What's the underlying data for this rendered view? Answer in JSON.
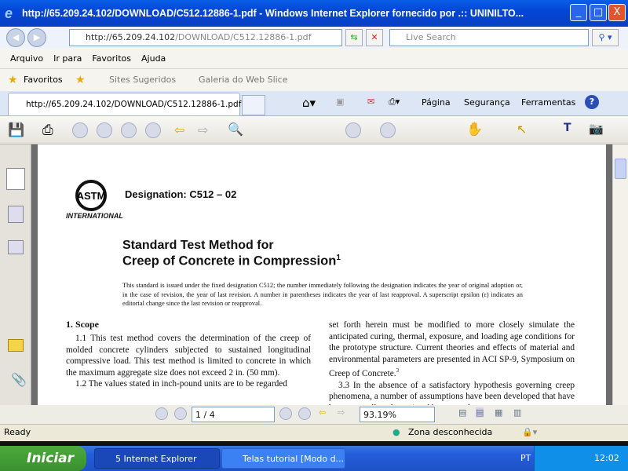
{
  "window": {
    "title": "http://65.209.24.102/DOWNLOAD/C512.12886-1.pdf - Windows Internet Explorer fornecido por .:: UNINILTO...",
    "minimize": "_",
    "maximize": "□",
    "close": "X"
  },
  "address": {
    "host": "http://65.209.24.102",
    "path": "/DOWNLOAD/C512.12886-1.pdf",
    "search_placeholder": "Live Search"
  },
  "menu": [
    "Arquivo",
    "Ir para",
    "Favoritos",
    "Ajuda"
  ],
  "favorites": {
    "label": "Favoritos",
    "items": [
      "Sites Sugeridos",
      "Galeria do Web Slice"
    ]
  },
  "tab": {
    "label": "http://65.209.24.102/DOWNLOAD/C512.12886-1.pdf"
  },
  "command_bar": [
    "Página",
    "Segurança",
    "Ferramentas"
  ],
  "document": {
    "designation": "Designation: C512 – 02",
    "logo_text": "INTERNATIONAL",
    "title_line1": "Standard Test Method for",
    "title_line2": "Creep of Concrete in Compression",
    "title_sup": "1",
    "notice": "This standard is issued under the fixed designation C512; the number immediately following the designation indicates the year of original adoption or, in the case of revision, the year of last revision. A number in parentheses indicates the year of last reapproval. A superscript epsilon (ε) indicates an editorial change since the last revision or reapproval.",
    "section_heading": "1. Scope",
    "left_p1": "1.1 This test method covers the determination of the creep of molded concrete cylinders subjected to sustained longitudinal compressive load. This test method is limited to concrete in which the maximum aggregate size does not exceed 2 in. (50 mm).",
    "left_p2": "1.2 The values stated in inch-pound units are to be regarded",
    "right_p1": "set forth herein must be modified to more closely simulate the anticipated curing, thermal, exposure, and loading age conditions for the prototype structure. Current theories and effects of material and environmental parameters are presented in ACI SP-9, Symposium on Creep of Concrete.",
    "right_p1_sup": "3",
    "right_p2": "3.3 In the absence of a satisfactory hypothesis governing creep phenomena, a number of assumptions have been developed that have been generally substantiated by test and"
  },
  "page_nav": {
    "page": "1 / 4",
    "zoom": "93.19%"
  },
  "status": {
    "text": "Ready",
    "zone": "Zona desconhecida"
  },
  "taskbar": {
    "start": "Iniciar",
    "tasks": [
      "5 Internet Explorer",
      "Telas tutorial [Modo d..."
    ],
    "lang": "PT",
    "clock": "12:02"
  }
}
